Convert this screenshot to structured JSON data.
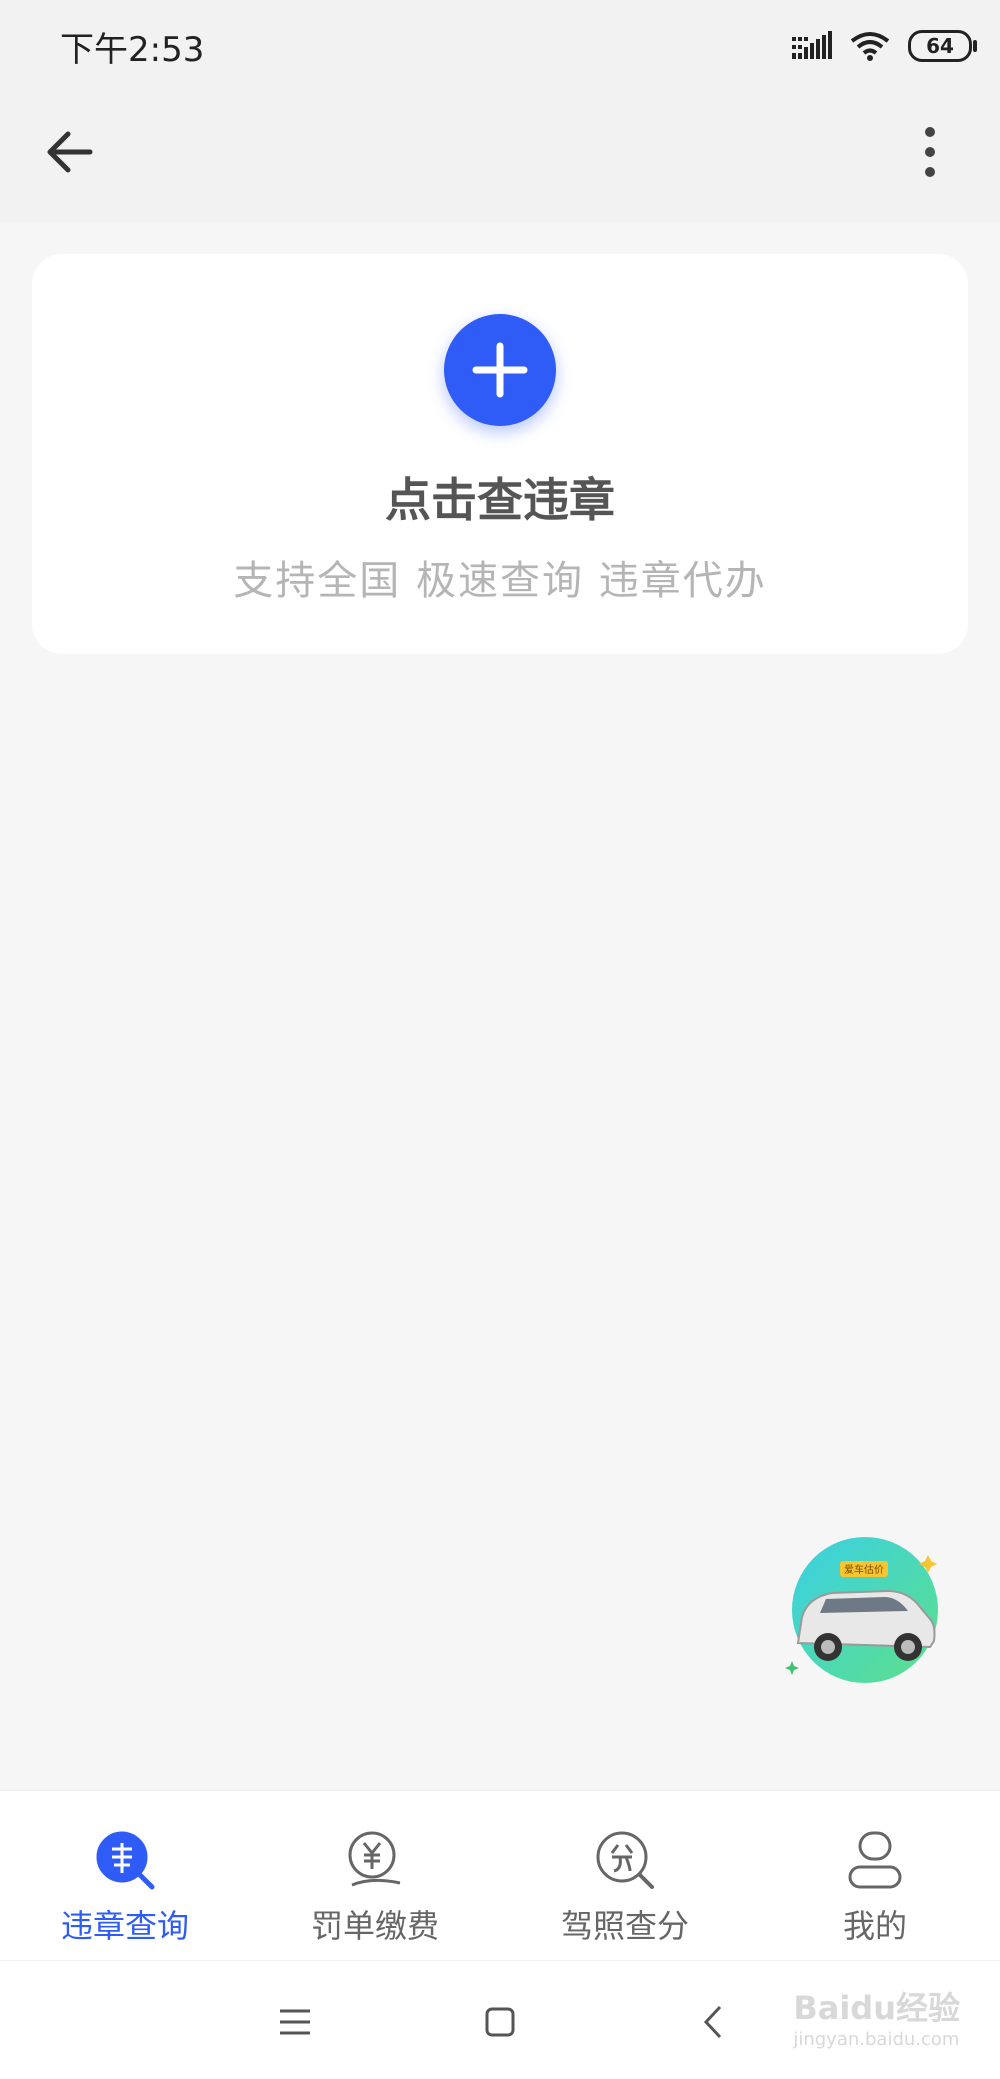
{
  "status_bar": {
    "time": "下午2:53",
    "battery": "64",
    "icons": [
      "signal-icon",
      "wifi-icon",
      "battery-icon"
    ]
  },
  "app_bar": {
    "back_icon": "arrow-left-icon",
    "more_icon": "more-vertical-icon"
  },
  "card": {
    "title": "点击查违章",
    "subtitle": "支持全国 极速查询 违章代办",
    "add_icon": "plus-icon"
  },
  "float_badge": {
    "text": "爱车估价"
  },
  "tabs": [
    {
      "label": "违章查询",
      "icon": "violation-search-icon",
      "active": true
    },
    {
      "label": "罚单缴费",
      "icon": "fine-payment-icon",
      "active": false
    },
    {
      "label": "驾照查分",
      "icon": "license-points-icon",
      "active": false
    },
    {
      "label": "我的",
      "icon": "profile-icon",
      "active": false
    }
  ],
  "nav_bar": {
    "icons": [
      "menu-icon",
      "home-icon",
      "back-icon"
    ],
    "watermark": "Baidu经验",
    "watermark_url": "jingyan.baidu.com"
  },
  "colors": {
    "accent": "#2f5cf6",
    "background": "#f6f6f6"
  }
}
